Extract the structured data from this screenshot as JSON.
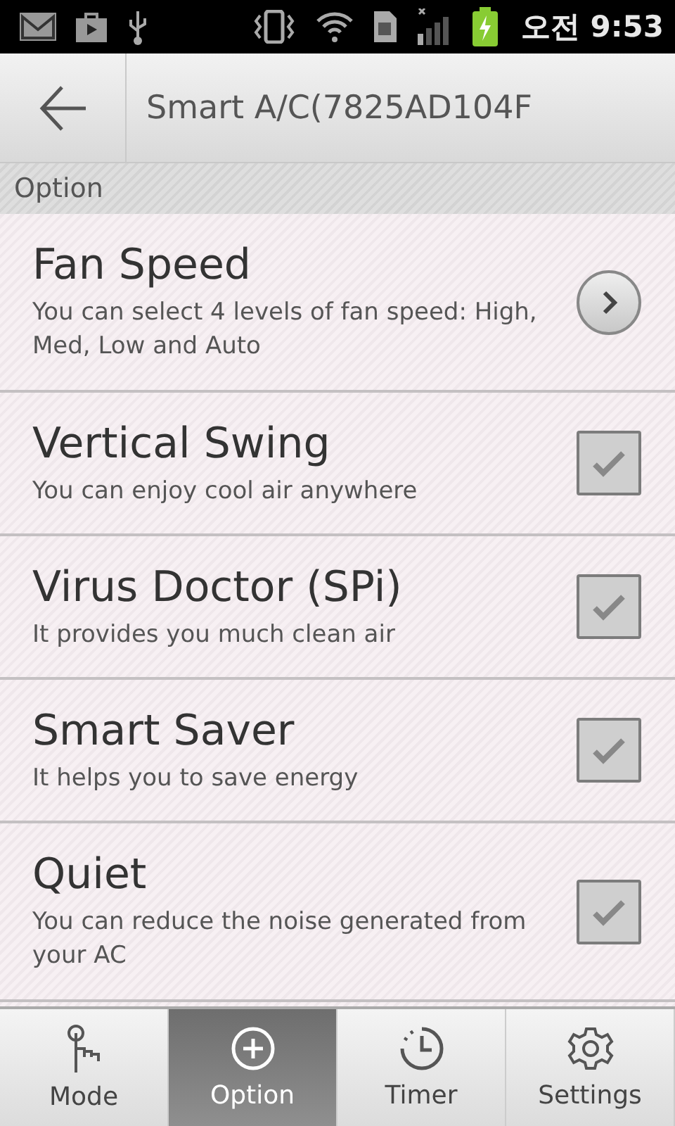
{
  "status_bar": {
    "time": "오전 9:53"
  },
  "header": {
    "title": "Smart A/C(7825AD104F"
  },
  "section": {
    "title": "Option"
  },
  "options": [
    {
      "kind": "arrow",
      "title": "Fan Speed",
      "description": "You can select 4 levels of fan speed: High, Med, Low and Auto"
    },
    {
      "kind": "checkbox",
      "title": "Vertical Swing",
      "description": "You can enjoy cool air anywhere",
      "checked": true
    },
    {
      "kind": "checkbox",
      "title": "Virus Doctor (SPi)",
      "description": "It provides you much clean air",
      "checked": true
    },
    {
      "kind": "checkbox",
      "title": "Smart Saver",
      "description": "It helps you to save energy",
      "checked": true
    },
    {
      "kind": "checkbox",
      "title": "Quiet",
      "description": "You can reduce the noise generated from your AC",
      "checked": true
    }
  ],
  "tabs": [
    {
      "kind": "mode",
      "label": "Mode",
      "selected": false
    },
    {
      "kind": "option",
      "label": "Option",
      "selected": true
    },
    {
      "kind": "timer",
      "label": "Timer",
      "selected": false
    },
    {
      "kind": "settings",
      "label": "Settings",
      "selected": false
    }
  ]
}
